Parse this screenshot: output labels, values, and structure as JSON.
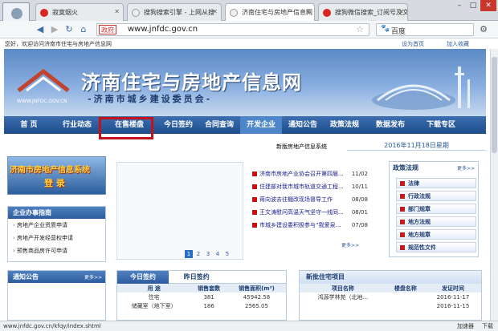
{
  "browser": {
    "tabs": [
      {
        "label": "寂寞烟火",
        "icon_color": "#d9251d"
      },
      {
        "label": "搜狗搜索引擎 - 上网从搜",
        "icon_color": "#e7e7e7"
      },
      {
        "label": "济南住宅与房地产信息网",
        "icon_color": "#e7e7e7"
      },
      {
        "label": "搜狗微信搜索_订阅号及文",
        "icon_color": "#d9251d"
      }
    ],
    "url_badge": "政府",
    "url": "www.jnfdc.gov.cn",
    "search_engine": "百度",
    "welcome": "您好，欢迎访问济南市住宅与房地产信息网",
    "set_home": "设为首页",
    "add_fav": "加入收藏"
  },
  "site": {
    "title": "济南住宅与房地产信息网",
    "subtitle": "-济南市城乡建设委员会-",
    "logo_text": "WWW.JNFDC.GOV.CN",
    "menu": [
      "首 页",
      "行业动态",
      "在售楼盘",
      "今日签约",
      "合同查询",
      "开发企业",
      "通知公告",
      "政策法规",
      "数据发布",
      "下载专区"
    ],
    "date": "2016年11月18日星期",
    "news_ticker": "新版房地产信息系统",
    "left_banner": {
      "line1": "济南市房地产信息系统",
      "line2": "登 录"
    }
  },
  "guide": {
    "title": "企业办事指南",
    "items": [
      "房地产企业资质申请",
      "房地产开发经营权申请",
      "预售商品房许可申请"
    ]
  },
  "news_list": [
    {
      "title": "济南市房地产业协会召开第四届...",
      "date": "11/02"
    },
    {
      "title": "住建部对我市城市轨道交通工程...",
      "date": "10/11"
    },
    {
      "title": "蒋向波去往棚改现场督导工作",
      "date": "08/08"
    },
    {
      "title": "王文涛慰问高温天气坚守一线同...",
      "date": "08/01"
    },
    {
      "title": "市城乡建设委积极参与“我爱泉...",
      "date": "07/08"
    }
  ],
  "news_more": "更多>>",
  "pager": [
    "1",
    "2",
    "3",
    "4",
    "5"
  ],
  "policy": {
    "title": "政策法规",
    "more": "更多>>",
    "items": [
      "法律",
      "行政法规",
      "部门规章",
      "地方法规",
      "地方规章",
      "规范性文件"
    ]
  },
  "notice": {
    "title": "通知公告",
    "more": "更多>>"
  },
  "signing": {
    "tabs": [
      "今日签约",
      "昨日签约"
    ],
    "headers": [
      "用 途",
      "销售套数",
      "销售面积(m²)"
    ],
    "rows": [
      [
        "住宅",
        "381",
        "45942.58"
      ],
      [
        "储藏室（地下室）",
        "186",
        "2565.05"
      ]
    ]
  },
  "new_homes": {
    "title": "新批住宅项目",
    "headers": [
      "项目名称",
      "楼盘名称",
      "发证时间"
    ],
    "rows": [
      [
        "鸿源学林苑（北地...",
        "",
        "2016-11-17"
      ],
      [
        "",
        "",
        "2016-11-15"
      ]
    ]
  },
  "status": {
    "url": "www.jnfdc.gov.cn/kfqy/index.shtml",
    "accel": "加速器",
    "download": "下载"
  }
}
